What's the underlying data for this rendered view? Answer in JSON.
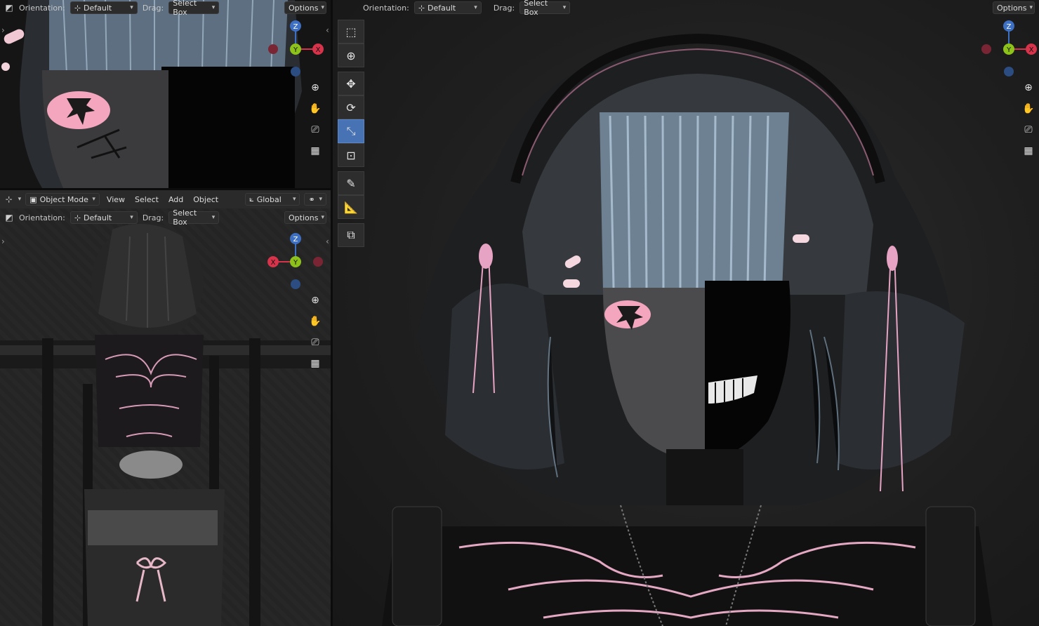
{
  "colors": {
    "axis_x": "#d7334a",
    "axis_y": "#8cc21a",
    "axis_z": "#3d6fc3",
    "active_tool": "#4772b3",
    "accent_pink": "#e7a3c3"
  },
  "viewport_header": {
    "orientation_label": "Orientation:",
    "orientation_value": "Default",
    "drag_label": "Drag:",
    "drag_value": "Select Box",
    "options_label": "Options"
  },
  "editor_menu": {
    "mode": "Object Mode",
    "items": [
      "View",
      "Select",
      "Add",
      "Object"
    ],
    "transform_orientation": "Global"
  },
  "gizmo": {
    "z": "Z",
    "y": "Y",
    "x": "X"
  },
  "toolbar": {
    "tools": [
      {
        "name": "select-box",
        "icon": "select-box-icon",
        "active": false
      },
      {
        "name": "cursor",
        "icon": "cursor-icon",
        "active": false
      },
      {
        "name": "move",
        "icon": "move-icon",
        "active": false
      },
      {
        "name": "rotate",
        "icon": "rotate-icon",
        "active": false
      },
      {
        "name": "scale",
        "icon": "scale-icon",
        "active": true
      },
      {
        "name": "transform",
        "icon": "transform-icon",
        "active": false
      },
      {
        "name": "annotate",
        "icon": "annotate-icon",
        "active": false
      },
      {
        "name": "measure",
        "icon": "measure-icon",
        "active": false
      },
      {
        "name": "add-cube",
        "icon": "add-cube-icon",
        "active": false
      }
    ]
  },
  "nav_controls": [
    "zoom-icon",
    "pan-hand-icon",
    "camera-icon",
    "grid-icon"
  ]
}
